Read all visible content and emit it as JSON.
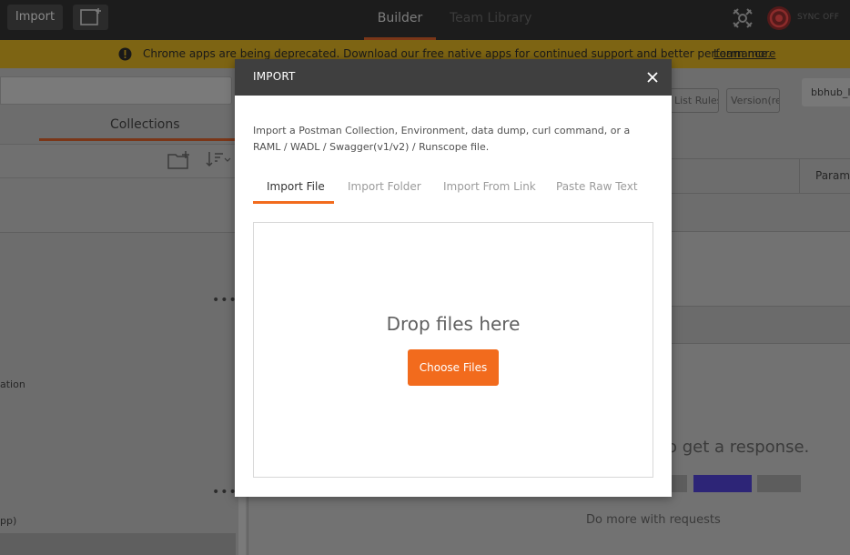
{
  "topbar": {
    "import_label": "Import",
    "new_window_icon": "new-window-icon",
    "nav": {
      "builder": "Builder",
      "team_library": "Team Library"
    },
    "interceptor_icon": "satellite-icon",
    "sync_icon": "sync-status-icon",
    "sync_label": "SYNC OFF"
  },
  "banner": {
    "icon": "alert-circle-icon",
    "message": "Chrome apps are being deprecated. Download our free native apps for continued support and better performance.",
    "link": "Learn more"
  },
  "sidebar": {
    "tab_collections": "Collections",
    "add_folder_icon": "add-folder-icon",
    "sort_icon": "sort-icon",
    "more_icon": "•••",
    "item_fragment_1": "ation",
    "item_fragment_2": "pp)"
  },
  "main": {
    "chip_list_rules": "List Rules",
    "chip_version": "Version(re",
    "environment_fragment": "bbhub_I",
    "params_fragment": "Param",
    "response_fragment": "o get a response.",
    "do_more": "Do more with requests"
  },
  "modal": {
    "title": "IMPORT",
    "close_icon": "close-icon",
    "description": "Import a Postman Collection, Environment, data dump, curl command, or a RAML / WADL / Swagger(v1/v2) / Runscope file.",
    "tabs": [
      "Import File",
      "Import Folder",
      "Import From Link",
      "Paste Raw Text"
    ],
    "active_tab": "Import File",
    "drop_text": "Drop files here",
    "choose_button": "Choose Files"
  },
  "colors": {
    "accent": "#f26b1d",
    "modal_header": "#3f3f3f",
    "banner_dim": "#7d6413"
  }
}
